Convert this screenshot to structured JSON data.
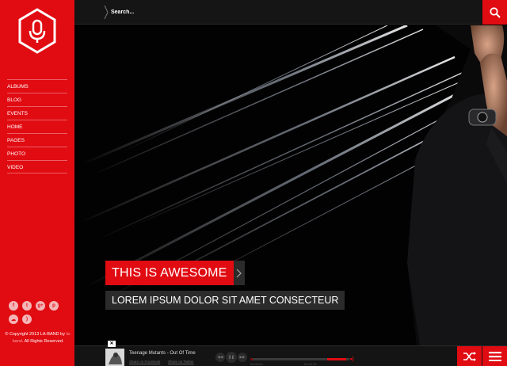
{
  "sidebar": {
    "nav": [
      {
        "label": "ALBUMS"
      },
      {
        "label": "BLOG"
      },
      {
        "label": "EVENTS"
      },
      {
        "label": "HOME"
      },
      {
        "label": "PAGES"
      },
      {
        "label": "PHOTO"
      },
      {
        "label": "VIDEO"
      }
    ],
    "social_icons": [
      "facebook-icon",
      "twitter-icon",
      "google-plus-icon",
      "pinterest-icon",
      "soundcloud-icon",
      "rss-icon"
    ],
    "copyright_prefix": "© Copyright 2013 LA-BAND by",
    "copyright_brand": "la-band",
    "copyright_suffix": ". All Rights Reserved."
  },
  "search": {
    "placeholder": "Search..."
  },
  "hero": {
    "title": "THIS IS AWESOME",
    "subtitle": "LOREM IPSUM DOLOR SIT AMET CONSECTEUR"
  },
  "player": {
    "track": "Teenage Mutants - Out Of Time",
    "share_facebook": "Share on Facebook",
    "share_twitter": "Share on Twitter",
    "time_elapsed": "00:00:00",
    "time_total": "00:03:35",
    "progress": 0.02
  },
  "colors": {
    "accent": "#e10b12",
    "background": "#000000",
    "bar": "#151515"
  }
}
